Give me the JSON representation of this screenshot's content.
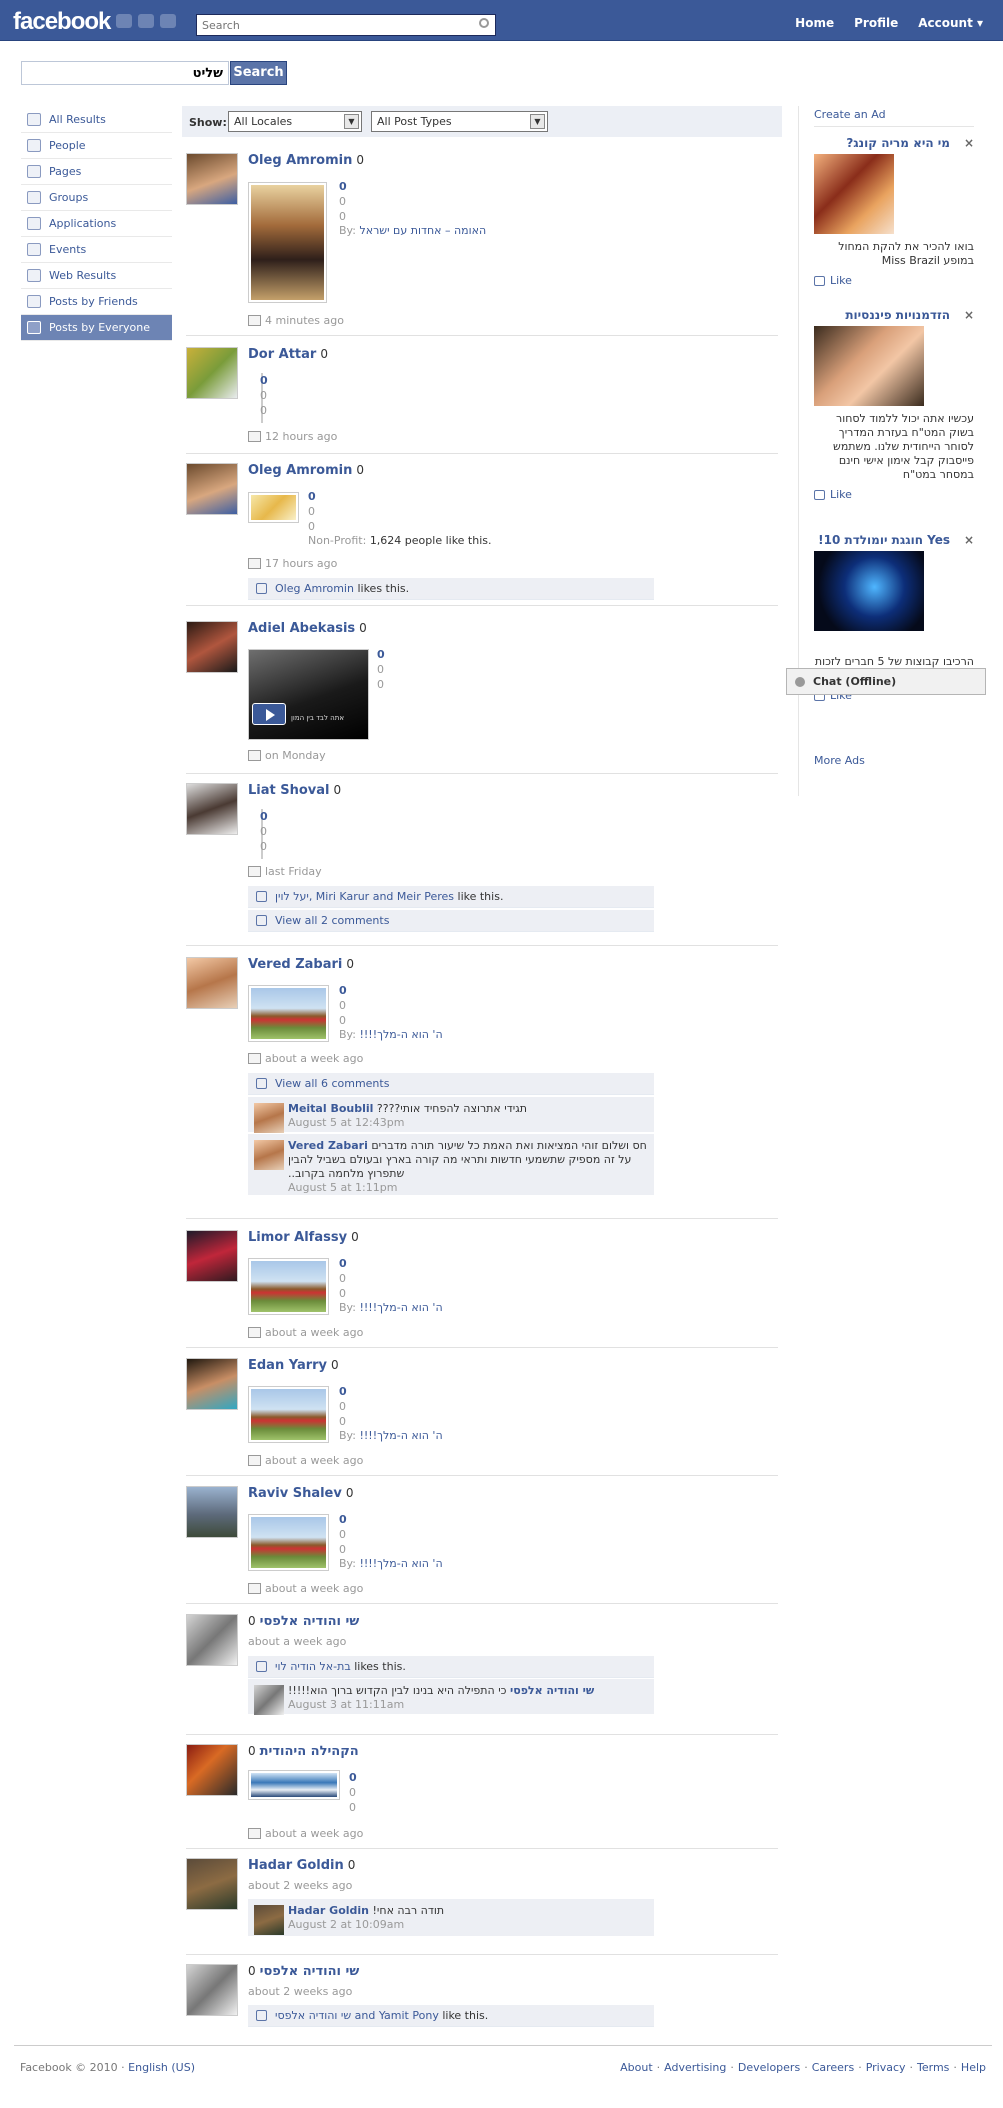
{
  "topbar": {
    "logo": "facebook",
    "search_placeholder": "Search",
    "nav": [
      "Home",
      "Profile",
      "Account ▾"
    ]
  },
  "query": {
    "value": "שליט",
    "button": "Search"
  },
  "left_nav": [
    {
      "label": "All Results",
      "icon": "magnifier-icon"
    },
    {
      "label": "People",
      "icon": "person-icon"
    },
    {
      "label": "Pages",
      "icon": "flag-icon"
    },
    {
      "label": "Groups",
      "icon": "group-icon"
    },
    {
      "label": "Applications",
      "icon": "app-icon"
    },
    {
      "label": "Events",
      "icon": "calendar-icon"
    },
    {
      "label": "Web Results",
      "icon": "globe-icon"
    },
    {
      "label": "Posts by Friends",
      "icon": "posts-icon"
    },
    {
      "label": "Posts by Everyone",
      "icon": "posts-icon",
      "selected": true
    }
  ],
  "filters": {
    "label": "Show:",
    "locale": "All Locales",
    "post_type": "All Post Types"
  },
  "stories": [
    {
      "name": "Oleg Amromin",
      "count": "0",
      "lines": [
        "0",
        "0",
        "0"
      ],
      "by_label": "By:",
      "by": "האומה – אחדות עם ישראל",
      "time": "4 minutes ago"
    },
    {
      "name": "Dor Attar",
      "count": "0",
      "lines": [
        "0",
        "0",
        "0"
      ],
      "time": "12 hours ago"
    },
    {
      "name": "Oleg Amromin",
      "count": "0",
      "lines": [
        "0",
        "0",
        "0"
      ],
      "type_label": "Non-Profit:",
      "type_value": "1,624 people like this.",
      "time": "17 hours ago",
      "likes": {
        "names": "Oleg Amromin",
        "suffix": "likes this."
      }
    },
    {
      "name": "Adiel Abekasis",
      "count": "0",
      "lines": [
        "0",
        "0",
        "0"
      ],
      "video_caption": "אתה לבד בין המון",
      "time": "on Monday"
    },
    {
      "name": "Liat Shoval",
      "count": "0",
      "lines": [
        "0",
        "0",
        "0"
      ],
      "time": "last Friday",
      "likes": {
        "names": "יעל לוין, Miri Karur and Meir Peres",
        "suffix": "like this."
      },
      "view_all": "View all 2 comments"
    },
    {
      "name": "Vered Zabari",
      "count": "0",
      "lines": [
        "0",
        "0",
        "0"
      ],
      "by_label": "By:",
      "by": "ה' הוא ה-מלך!!!!",
      "time": "about a week ago",
      "view_all": "View all 6 comments",
      "comments": [
        {
          "name": "Meital Boublil",
          "text": "תגידי אתרוצה להפחיד אותי????",
          "time": "August 5 at 12:43pm"
        },
        {
          "name": "Vered Zabari",
          "text": "חס ושלום זוהי המציאות ואת האמת כל שיעור תורה מדברים על זה מספיק שתשמעי חדשות ותראי מה קורה בארץ ובעולם בשביל להבין שתפרוץ מלחמה בקרוב..",
          "time": "August 5 at 1:11pm"
        }
      ]
    },
    {
      "name": "Limor Alfassy",
      "count": "0",
      "lines": [
        "0",
        "0",
        "0"
      ],
      "by_label": "By:",
      "by": "ה' הוא ה-מלך!!!!",
      "time": "about a week ago"
    },
    {
      "name": "Edan Yarry",
      "count": "0",
      "lines": [
        "0",
        "0",
        "0"
      ],
      "by_label": "By:",
      "by": "ה' הוא ה-מלך!!!!",
      "time": "about a week ago"
    },
    {
      "name": "Raviv Shalev",
      "count": "0",
      "lines": [
        "0",
        "0",
        "0"
      ],
      "by_label": "By:",
      "by": "ה' הוא ה-מלך!!!!",
      "time": "about a week ago"
    },
    {
      "name": "שי והודיה אלפסי",
      "count": "0",
      "time": "about a week ago",
      "likes": {
        "names": "בת-אל הודיה לוי",
        "suffix": "likes this."
      },
      "comments": [
        {
          "name": "שי והודיה אלפסי",
          "text": "כי התפילה היא בנינו לבין הקדוש ברוך הוא!!!!!",
          "time": "August 3 at 11:11am"
        }
      ]
    },
    {
      "name": "הקהילה היהודית",
      "count": "0",
      "lines": [
        "0",
        "0",
        "0"
      ],
      "time": "about a week ago"
    },
    {
      "name": "Hadar Goldin",
      "count": "0",
      "time": "about 2 weeks ago",
      "comments": [
        {
          "name": "Hadar Goldin",
          "text": "תודה רבה אחי!",
          "time": "August 2 at 10:09am"
        }
      ]
    },
    {
      "name": "שי והודיה אלפסי",
      "count": "0",
      "time": "about 2 weeks ago",
      "likes": {
        "names": "שי והודיה אלפסי and Yamit Pony",
        "suffix": "like this."
      }
    }
  ],
  "ads": {
    "create_label": "Create an Ad",
    "more_label": "More Ads",
    "like_label": "Like",
    "items": [
      {
        "title": "מי היא מריה קונג?",
        "text": "בואו להכיר את להקת המחול במופע Miss Brazil"
      },
      {
        "title": "הזדמנויות פיננסיות",
        "text": "עכשיו אתה יכול ללמוד לסחור בשוק המט\"ח בעזרת המדריך לסוחר הייחודית שלנו. משתמש פייסבוק קבל אימון אישי חינם במסחר במט\"ח"
      },
      {
        "title": "Yes חוגגת יומולדת 10!",
        "text": "הרכיבו קבוצות של 5 חברים לזכות בפרס הגדול ! *בכפוף לתקנון"
      }
    ]
  },
  "chat": {
    "label": "Chat (Offline)"
  },
  "footer": {
    "copyright": "Facebook © 2010 ·",
    "language": "English (US)",
    "links": [
      "About",
      "Advertising",
      "Developers",
      "Careers",
      "Privacy",
      "Terms",
      "Help"
    ]
  }
}
